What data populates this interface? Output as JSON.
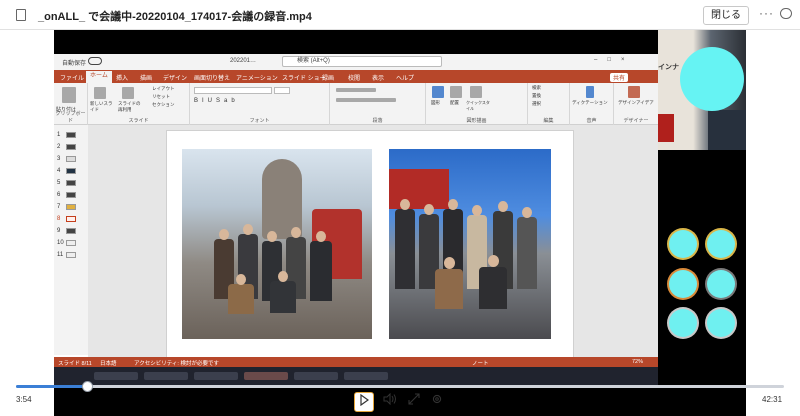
{
  "header": {
    "title": "_onALL_ で会議中-20220104_174017-会議の録音.mp4",
    "close_label": "閉じる",
    "more_label": "···"
  },
  "powerpoint": {
    "autosave_label": "自動保存",
    "filename": "202201…",
    "search_placeholder": "検索 (Alt+Q)",
    "tabs": [
      "ファイル",
      "ホーム",
      "挿入",
      "描画",
      "デザイン",
      "画面切り替え",
      "アニメーション",
      "スライド ショー",
      "録画",
      "校閲",
      "表示",
      "ヘルプ"
    ],
    "active_tab": "ホーム",
    "share_label": "共有",
    "ribbon_groups": [
      "クリップボード",
      "スライド",
      "フォント",
      "段落",
      "図形描画",
      "編集",
      "音声",
      "デザイナー"
    ],
    "ribbon_buttons": {
      "paste": "貼り付け",
      "new_slide": "新しいスライド",
      "reuse_slide": "スライドの再利用",
      "layout": "レイアウト",
      "reset": "リセット",
      "section": "セクション",
      "shape": "図形",
      "arrange": "配置",
      "quick_styles": "クイックスタイル",
      "find": "検索",
      "replace": "置換",
      "select": "選択",
      "dictation": "ディクテーション",
      "designer": "デザインアイデア"
    },
    "slide_numbers": [
      "1",
      "2",
      "3",
      "4",
      "5",
      "6",
      "7",
      "8",
      "9",
      "10",
      "11"
    ],
    "selected_slide": "8",
    "status_slide": "スライド 8/11",
    "status_lang": "日本語",
    "status_accessibility": "アクセシビリティ: 検討が必要です",
    "status_notes": "ノート",
    "zoom": "72%"
  },
  "camera": {
    "sign_text": "インナ"
  },
  "player": {
    "current_time": "3:54",
    "total_time": "42:31",
    "progress_fraction": 0.092
  }
}
